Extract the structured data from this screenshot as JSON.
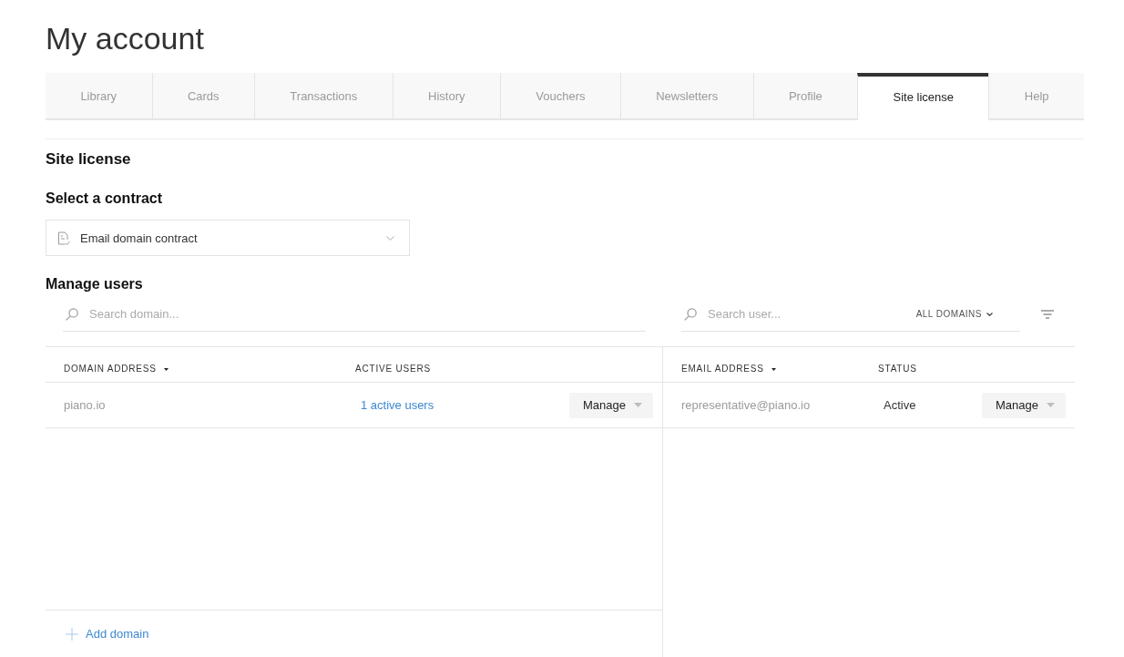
{
  "page_title": "My account",
  "tabs": [
    {
      "label": "Library",
      "selected": false
    },
    {
      "label": "Cards",
      "selected": false
    },
    {
      "label": "Transactions",
      "selected": false
    },
    {
      "label": "History",
      "selected": false
    },
    {
      "label": "Vouchers",
      "selected": false
    },
    {
      "label": "Newsletters",
      "selected": false
    },
    {
      "label": "Profile",
      "selected": false
    },
    {
      "label": "Site license",
      "selected": true
    },
    {
      "label": "Help",
      "selected": false
    }
  ],
  "section_title": "Site license",
  "contract_select": {
    "label": "Select a contract",
    "value": "Email domain contract"
  },
  "manage_users": {
    "title": "Manage users",
    "domains_panel": {
      "search": {
        "placeholder": "Search domain..."
      },
      "columns": [
        {
          "label": "DOMAIN ADDRESS",
          "sorted": true
        },
        {
          "label": "ACTIVE USERS",
          "sorted": false
        }
      ],
      "rows": [
        {
          "domain": "piano.io",
          "active_users": "1 active users",
          "action": "Manage"
        }
      ],
      "add_button": "Add domain"
    },
    "users_panel": {
      "search": {
        "placeholder": "Search user..."
      },
      "domain_filter": "ALL DOMAINS",
      "columns": [
        {
          "label": "EMAIL ADDRESS",
          "sorted": true
        },
        {
          "label": "STATUS",
          "sorted": false
        }
      ],
      "rows": [
        {
          "email": "representative@piano.io",
          "status": "Active",
          "action": "Manage"
        }
      ]
    }
  }
}
